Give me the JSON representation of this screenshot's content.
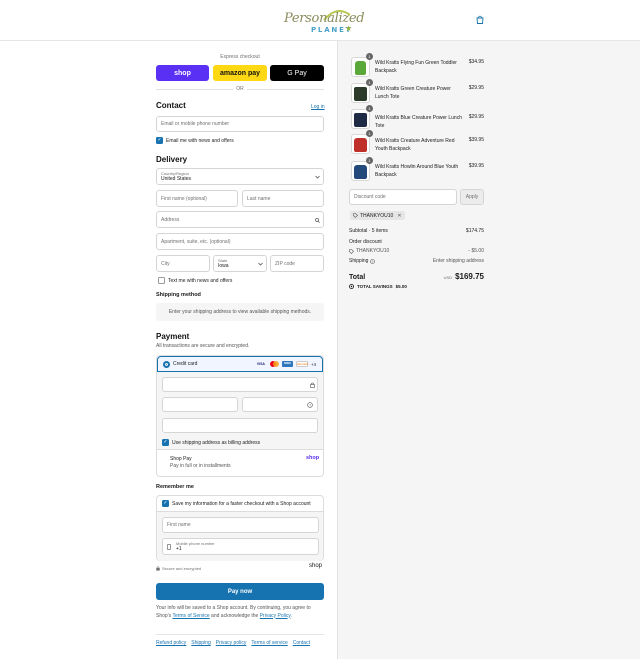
{
  "header": {
    "logo_script": "Personalized",
    "logo_word": "PLANET"
  },
  "express": {
    "label": "Express checkout",
    "shop_pay": "shop",
    "amazon_pay": "amazon pay",
    "gpay": "G Pay",
    "or": "OR"
  },
  "contact": {
    "title": "Contact",
    "login": "Log in",
    "email_placeholder": "Email or mobile phone number",
    "news_label": "Email me with news and offers"
  },
  "delivery": {
    "title": "Delivery",
    "country_label": "Country/Region",
    "country_value": "United States",
    "first_name": "First name (optional)",
    "last_name": "Last name",
    "address": "Address",
    "apartment": "Apartment, suite, etc. (optional)",
    "city": "City",
    "state_label": "State",
    "state_value": "Iowa",
    "zip": "ZIP code",
    "text_label": "Text me with news and offers"
  },
  "shipping": {
    "title": "Shipping method",
    "message": "Enter your shipping address to view available shipping methods."
  },
  "payment": {
    "title": "Payment",
    "subtitle": "All transactions are secure and encrypted.",
    "credit_card": "Credit card",
    "more_cards": "+4",
    "brands": [
      {
        "name": "VISA",
        "color": "#1a1f71"
      },
      {
        "name": "MC",
        "color": "#eb001b"
      },
      {
        "name": "AMEX",
        "color": "#2e77bc"
      },
      {
        "name": "DISCOVER",
        "color": "#f58220"
      }
    ],
    "billing_label": "Use shipping address as billing address",
    "shop_pay_title": "Shop Pay",
    "shop_pay_sub": "Pay in full or in installments",
    "shop_pay_logo": "shop"
  },
  "remember": {
    "title": "Remember me",
    "save_label": "Save my information for a faster checkout with a Shop account",
    "first_name": "First name",
    "phone_label": "Mobile phone number",
    "phone_value": "+1"
  },
  "secure": {
    "text": "Secure and encrypted",
    "logo": "shop"
  },
  "pay_now": "Pay now",
  "disclaimer": {
    "before": "Your info will be saved to a Shop account. By continuing, you agree to Shop's ",
    "tos": "Terms of Service",
    "middle": " and acknowledge the ",
    "privacy": "Privacy Policy",
    "after": "."
  },
  "footer_links": [
    "Refund policy",
    "Shipping",
    "Privacy policy",
    "Terms of service",
    "Contact"
  ],
  "cart": {
    "items": [
      {
        "name": "Wild Kratts Flying Fun Green Toddler Backpack",
        "price": "$34.95",
        "qty": "1",
        "color": "#5aa83a"
      },
      {
        "name": "Wild Kratts Green Creature Power Lunch Tote",
        "price": "$29.95",
        "qty": "1",
        "color": "#2c3a2c"
      },
      {
        "name": "Wild Kratts Blue Creature Power Lunch Tote",
        "price": "$29.95",
        "qty": "1",
        "color": "#1f2a44"
      },
      {
        "name": "Wild Kratts Creature Adventure Red Youth Backpack",
        "price": "$39.95",
        "qty": "1",
        "color": "#c0302a"
      },
      {
        "name": "Wild Kratts Howlin Around Blue Youth Backpack",
        "price": "$39.95",
        "qty": "1",
        "color": "#234a7a"
      }
    ],
    "discount_placeholder": "Discount code",
    "apply": "Apply",
    "code_tag": "THANKYOU10",
    "subtotal_label": "Subtotal · 5 items",
    "subtotal_value": "$174.75",
    "order_discount_label": "Order discount",
    "discount_code": "THANKYOU10",
    "discount_value": "- $5.00",
    "shipping_label": "Shipping",
    "shipping_value": "Enter shipping address",
    "total_label": "Total",
    "currency": "USD",
    "total_value": "$169.75",
    "savings_label": "TOTAL SAVINGS",
    "savings_value": "$5.00"
  }
}
